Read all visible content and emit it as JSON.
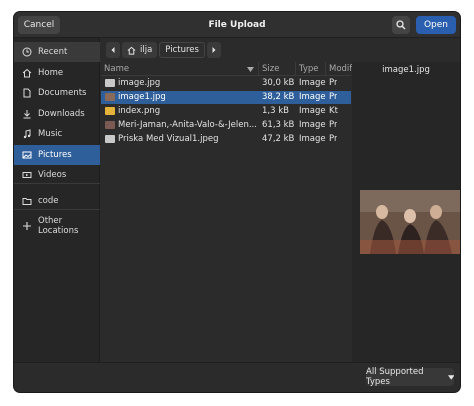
{
  "header": {
    "cancel_label": "Cancel",
    "title": "File Upload",
    "open_label": "Open",
    "search_icon": "search-icon"
  },
  "sidebar": {
    "items": [
      {
        "label": "Recent",
        "icon": "clock-icon"
      },
      {
        "label": "Home",
        "icon": "home-icon"
      },
      {
        "label": "Documents",
        "icon": "document-icon"
      },
      {
        "label": "Downloads",
        "icon": "download-icon"
      },
      {
        "label": "Music",
        "icon": "music-icon"
      },
      {
        "label": "Pictures",
        "icon": "pictures-icon"
      },
      {
        "label": "Videos",
        "icon": "video-icon"
      },
      {
        "label": "code",
        "icon": "folder-icon"
      },
      {
        "label": "Other Locations",
        "icon": "plus-icon"
      }
    ]
  },
  "pathbar": {
    "home_label": "ilja",
    "current_label": "Pictures"
  },
  "filelist": {
    "columns": {
      "name": "Name",
      "size": "Size",
      "type": "Type",
      "modified": "Modified"
    },
    "rows": [
      {
        "name": "image.jpg",
        "size": "30,0 kB",
        "type": "Image",
        "modified": "Pr"
      },
      {
        "name": "image1.jpg",
        "size": "38,2 kB",
        "type": "Image",
        "modified": "Pr"
      },
      {
        "name": "index.png",
        "size": "1,3 kB",
        "type": "Image",
        "modified": "Kt"
      },
      {
        "name": "Meri-Jaman,-Anita-Valo-&-Jelen...",
        "size": "61,3 kB",
        "type": "Image",
        "modified": "Pr"
      },
      {
        "name": "Priska Med Vizual1.jpeg",
        "size": "47,2 kB",
        "type": "Image",
        "modified": "Pr"
      }
    ]
  },
  "preview": {
    "filename": "image1.jpg"
  },
  "footer": {
    "filter_label": "All Supported Types"
  },
  "colors": {
    "accent": "#2f5f9a",
    "open_button": "#2a5fb0",
    "background": "#2b2b2b"
  }
}
